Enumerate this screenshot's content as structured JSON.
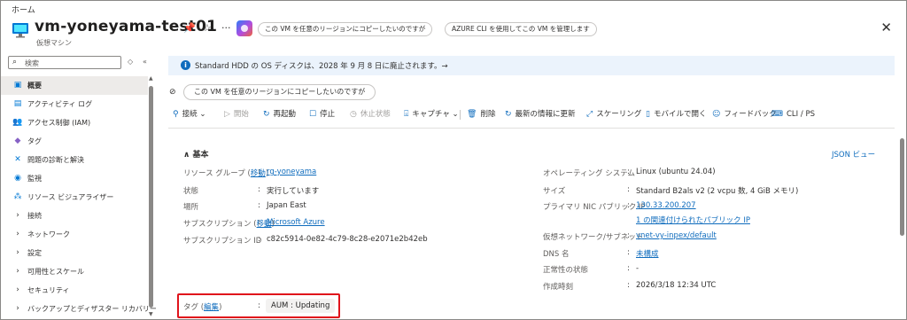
{
  "breadcrumb": "ホーム",
  "header": {
    "title": "vm-yoneyama-test01",
    "subtitle": "仮想マシン",
    "pills": [
      "この VM を任意のリージョンにコピーしたいのですが",
      "AZURE CLI を使用してこの VM を管理します"
    ]
  },
  "sidebar": {
    "search_placeholder": "検索",
    "items": [
      {
        "label": "概要",
        "icon": "monitor-icon"
      },
      {
        "label": "アクティビティ ログ",
        "icon": "activity-log-icon"
      },
      {
        "label": "アクセス制御 (IAM)",
        "icon": "iam-icon"
      },
      {
        "label": "タグ",
        "icon": "tag-icon"
      },
      {
        "label": "問題の診断と解決",
        "icon": "wrench-icon"
      },
      {
        "label": "監視",
        "icon": "monitor-gauge-icon"
      },
      {
        "label": "リソース ビジュアライザー",
        "icon": "visualizer-icon"
      },
      {
        "label": "接続",
        "icon": "chevron-right-icon"
      },
      {
        "label": "ネットワーク",
        "icon": "chevron-right-icon"
      },
      {
        "label": "設定",
        "icon": "chevron-right-icon"
      },
      {
        "label": "可用性とスケール",
        "icon": "chevron-right-icon"
      },
      {
        "label": "セキュリティ",
        "icon": "chevron-right-icon"
      },
      {
        "label": "バックアップとディザスター リカバリー",
        "icon": "chevron-right-icon"
      }
    ]
  },
  "banner": {
    "text": "Standard HDD の OS ディスクは、2028 年 9 月 8 日に廃止されます。→"
  },
  "suggestion": {
    "label": "この VM を任意のリージョンにコピーしたいのですが"
  },
  "toolbar": {
    "connect": "接続",
    "start": "開始",
    "restart": "再起動",
    "stop": "停止",
    "hibernate": "休止状態",
    "capture": "キャプチャ",
    "delete": "削除",
    "refresh": "最新の情報に更新",
    "scaling": "スケーリング",
    "mobile": "モバイルで開く",
    "feedback": "フィードバック",
    "cli": "CLI / PS"
  },
  "essentials": {
    "heading": "基本",
    "json_view": "JSON ビュー",
    "left": {
      "resource_group": {
        "label": "リソース グループ",
        "move": "移動",
        "value": "rg-yoneyama"
      },
      "status": {
        "label": "状態",
        "value": "実行しています"
      },
      "location": {
        "label": "場所",
        "value": "Japan East"
      },
      "subscription": {
        "label": "サブスクリプション",
        "move": "移動",
        "value": "Microsoft Azure"
      },
      "subscription_id": {
        "label": "サブスクリプション ID",
        "value": "c82c5914-0e82-4c79-8c28-e2071e2b42eb"
      }
    },
    "right": {
      "os": {
        "label": "オペレーティング システム",
        "value": "Linux (ubuntu 24.04)"
      },
      "size": {
        "label": "サイズ",
        "value": "Standard B2als v2 (2 vcpu 数, 4 GiB メモリ)"
      },
      "public_ip": {
        "label": "プライマリ NIC パブリック IP",
        "value": "130.33.200.207",
        "extra": "1 の関連付けられたパブリック IP"
      },
      "vnet": {
        "label": "仮想ネットワーク/サブネット",
        "value": "vnet-vy-inpex/default"
      },
      "dns": {
        "label": "DNS 名",
        "value": "未構成"
      },
      "health": {
        "label": "正常性の状態",
        "value": "-"
      },
      "created": {
        "label": "作成時刻",
        "value": "2026/3/18 12:34 UTC"
      }
    },
    "tags": {
      "label": "タグ",
      "edit": "編集",
      "value": "AUM : Updating"
    }
  }
}
